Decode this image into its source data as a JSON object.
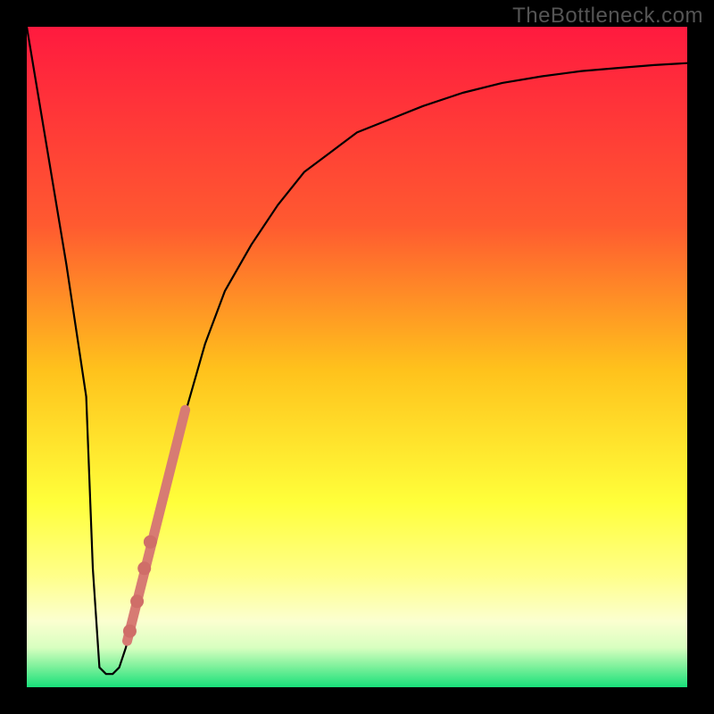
{
  "watermark": "TheBottleneck.com",
  "colors": {
    "top": "#ff1a3f",
    "upper_mid": "#ff6a2a",
    "mid": "#ffd21c",
    "lower_mid": "#ffff66",
    "pale": "#f5ffc8",
    "bottom": "#18e07a",
    "curve": "#000000",
    "dotted_line": "#d77b73",
    "dot": "#cf6e68"
  },
  "chart_data": {
    "type": "line",
    "title": "",
    "xlabel": "",
    "ylabel": "",
    "xlim": [
      0,
      100
    ],
    "ylim": [
      0,
      100
    ],
    "series": [
      {
        "name": "bottleneck-curve",
        "x": [
          0,
          3,
          6,
          9,
          10,
          11,
          12,
          13,
          14,
          15,
          17,
          19,
          21,
          23,
          25,
          27,
          30,
          34,
          38,
          42,
          46,
          50,
          55,
          60,
          66,
          72,
          78,
          84,
          90,
          95,
          100
        ],
        "y": [
          100,
          82,
          64,
          44,
          18,
          3,
          2,
          2,
          3,
          6,
          14,
          22,
          30,
          38,
          45,
          52,
          60,
          67,
          73,
          78,
          81,
          84,
          86,
          88,
          90,
          91.5,
          92.5,
          93.3,
          93.8,
          94.2,
          94.5
        ]
      }
    ],
    "optimal_band": {
      "x_start": 10.5,
      "x_end": 13.0,
      "floor_y": 2
    },
    "dotted_segment": {
      "x_start": 15.2,
      "y_start": 7,
      "x_end": 24.0,
      "y_end": 42
    },
    "dots": [
      {
        "x": 15.6,
        "y": 8.5
      },
      {
        "x": 16.7,
        "y": 13
      },
      {
        "x": 17.8,
        "y": 18
      },
      {
        "x": 18.7,
        "y": 22
      }
    ]
  }
}
